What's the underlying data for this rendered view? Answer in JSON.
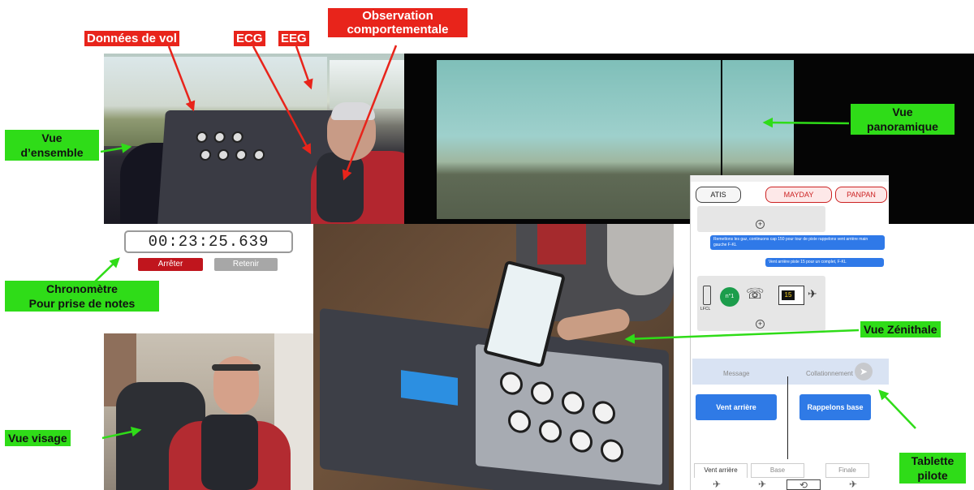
{
  "labels": {
    "flight_data": "Données de vol",
    "ecg": "ECG",
    "eeg": "EEG",
    "behavioral_line1": "Observation",
    "behavioral_line2": "comportementale",
    "overview_line1": "Vue",
    "overview_line2": "d’ensemble",
    "panorama_line1": "Vue",
    "panorama_line2": "panoramique",
    "chrono_line1": "Chronomètre",
    "chrono_line2": "Pour prise de notes",
    "zenith": "Vue Zénithale",
    "face": "Vue visage",
    "tablet_line1": "Tablette",
    "tablet_line2": "pilote"
  },
  "timer": {
    "display": "00:23:25.639",
    "stop_label": "Arrêter",
    "keep_label": "Retenir"
  },
  "tablet": {
    "atis": "ATIS",
    "mayday": "MAYDAY",
    "panpan": "PANPAN",
    "message_1": "Remettons les gaz, continuons cap 150 pour tour de piste rappelons vent arrière main gauche F-KL",
    "message_2": "Vent arrière piste 15 pour un complet, F-KL",
    "airport_code": "LFCL",
    "traffic_badge": "n°1",
    "runway_number": "15",
    "message_label": "Message",
    "collation_label": "Collationnement",
    "btn_downwind": "Vent arrière",
    "btn_callbase": "Rappelons base",
    "tab_downwind": "Vent arrière",
    "tab_base": "Base",
    "tab_final": "Finale"
  },
  "colors": {
    "annotation_red": "#e8241b",
    "annotation_green": "#2fdc18",
    "stop_button": "#c0151d",
    "tablet_blue": "#2f7ae6"
  }
}
